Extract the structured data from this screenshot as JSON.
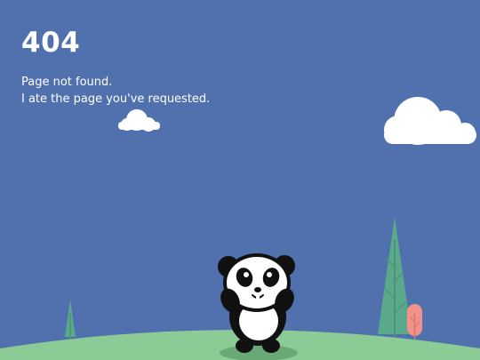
{
  "page": {
    "background_color": "#5071ad",
    "error_code": "404",
    "message_line1": "Page not found.",
    "message_line2": "I ate the page you've requested."
  },
  "scene": {
    "ground_color": "#8dcb96",
    "cloud_color": "#ffffff",
    "tree_color": "#5aa98a",
    "pink_tree_color": "#f0918a",
    "character": "panda"
  }
}
